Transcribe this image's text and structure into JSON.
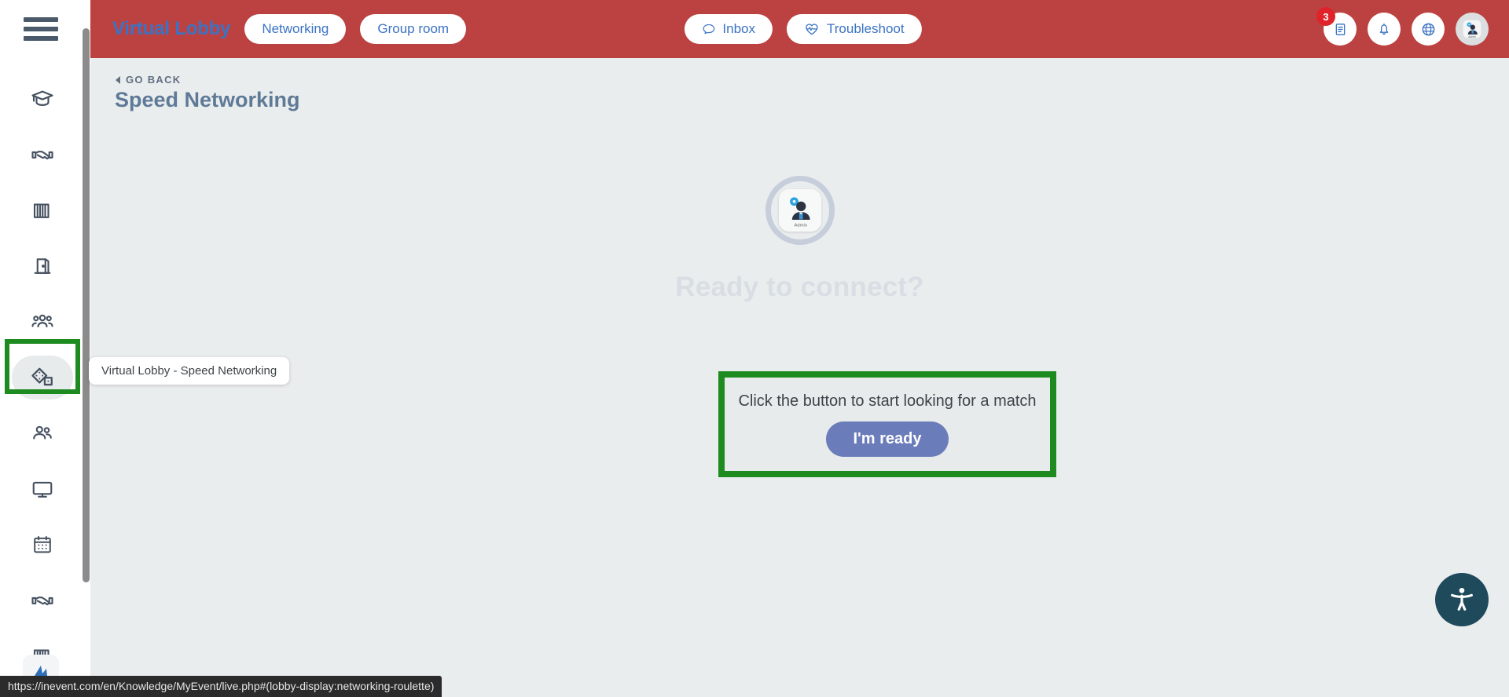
{
  "header": {
    "brand": "Virtual Lobby",
    "nav_pills": [
      {
        "label": "Networking",
        "icon": "none"
      },
      {
        "label": "Group room",
        "icon": "none"
      }
    ],
    "center_pills": [
      {
        "label": "Inbox",
        "icon": "chat-bubble-icon"
      },
      {
        "label": "Troubleshoot",
        "icon": "heart-pulse-icon"
      }
    ],
    "right_icons": [
      {
        "name": "agenda-document-icon",
        "badge": "3"
      },
      {
        "name": "bell-icon",
        "badge": ""
      },
      {
        "name": "globe-icon",
        "badge": ""
      },
      {
        "name": "user-avatar-icon",
        "badge": ""
      }
    ],
    "background_color": "#bc4242",
    "link_color": "#3b73c4",
    "badge_color": "#e0232b"
  },
  "sidebar": {
    "menu_icon": "hamburger-menu-icon",
    "items": [
      {
        "name": "sidebar-item-sessions",
        "icon": "graduation-cap-icon",
        "active": false
      },
      {
        "name": "sidebar-item-networking",
        "icon": "handshake-icon",
        "active": false
      },
      {
        "name": "sidebar-item-sponsors",
        "icon": "booth-barcode-icon",
        "active": false
      },
      {
        "name": "sidebar-item-exhibitors",
        "icon": "door-icon",
        "active": false
      },
      {
        "name": "sidebar-item-attendees",
        "icon": "people-group-icon",
        "active": false
      },
      {
        "name": "sidebar-item-speed-networking",
        "icon": "dice-icon",
        "active": true
      },
      {
        "name": "sidebar-item-my-contacts",
        "icon": "two-people-icon",
        "active": false
      },
      {
        "name": "sidebar-item-live-stream",
        "icon": "monitor-icon",
        "active": false
      },
      {
        "name": "sidebar-item-schedule",
        "icon": "calendar-icon",
        "active": false
      },
      {
        "name": "sidebar-item-meetings",
        "icon": "handshake-icon",
        "active": false
      },
      {
        "name": "sidebar-item-booths",
        "icon": "booth-barcode-icon",
        "active": false
      }
    ],
    "logo": "inevent-logo-icon",
    "highlight_color": "#1e8b20"
  },
  "tooltip": {
    "text": "Virtual Lobby - Speed Networking"
  },
  "main": {
    "go_back_label": "GO BACK",
    "page_title": "Speed Networking",
    "avatar": {
      "image_label": "Admin",
      "alt": "admin-avatar"
    },
    "ready_heading": "Ready to connect?",
    "match_prompt": "Click the button to start looking for a match",
    "ready_button_label": "I'm ready",
    "ready_button_color": "#6b7cba",
    "highlight_color": "#1e8b20",
    "background_color": "#eaedee"
  },
  "accessibility": {
    "icon": "accessibility-person-icon",
    "color": "#1f4a5c"
  },
  "status_bar": {
    "url": "https://inevent.com/en/Knowledge/MyEvent/live.php#(lobby-display:networking-roulette)"
  }
}
